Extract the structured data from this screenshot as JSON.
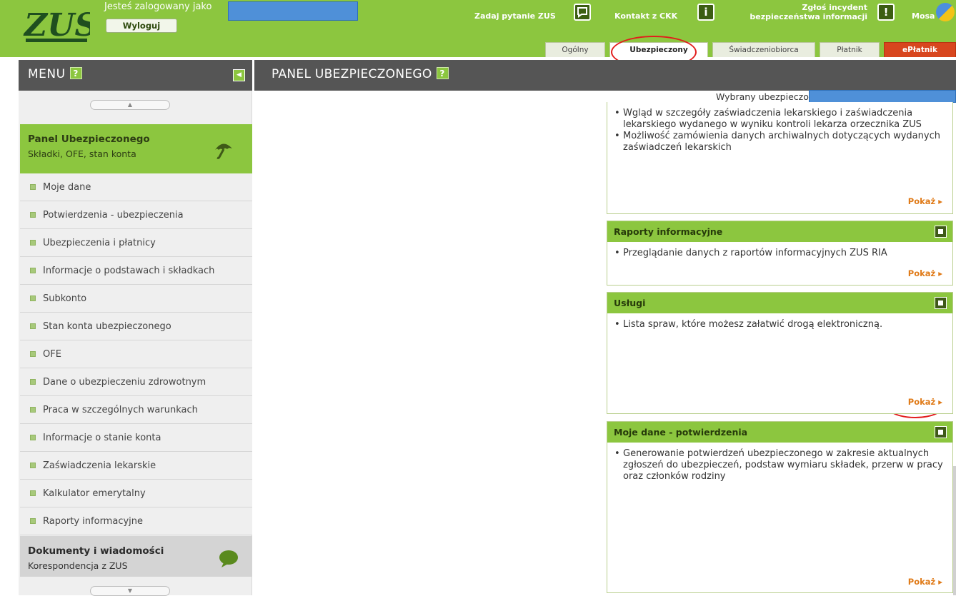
{
  "header": {
    "logged_as": "Jesteś zalogowany jako",
    "logout": "Wyloguj",
    "ask_zus": "Zadaj pytanie ZUS",
    "contact_ckk": "Kontakt z CKK",
    "incident_line1": "Zgłoś incydent",
    "incident_line2": "bezpieczeństwa informacji",
    "mode": "Mosa"
  },
  "tabs": [
    {
      "label": "Ogólny"
    },
    {
      "label": "Ubezpieczony"
    },
    {
      "label": "Świadczeniobiorca"
    },
    {
      "label": "Płatnik"
    },
    {
      "label": "ePłatnik"
    }
  ],
  "menu": {
    "title": "MENU",
    "help": "?",
    "panel": {
      "title": "Panel Ubezpieczonego",
      "subtitle": "Składki, OFE, stan konta"
    },
    "items": [
      {
        "label": "Moje dane"
      },
      {
        "label": "Potwierdzenia - ubezpieczenia"
      },
      {
        "label": "Ubezpieczenia i płatnicy"
      },
      {
        "label": "Informacje o podstawach i składkach"
      },
      {
        "label": "Subkonto"
      },
      {
        "label": "Stan konta ubezpieczonego"
      },
      {
        "label": "OFE"
      },
      {
        "label": "Dane o ubezpieczeniu zdrowotnym"
      },
      {
        "label": "Praca w szczególnych warunkach"
      },
      {
        "label": "Informacje o stanie konta"
      },
      {
        "label": "Zaświadczenia lekarskie"
      },
      {
        "label": "Kalkulator emerytalny"
      },
      {
        "label": "Raporty informacyjne"
      }
    ],
    "docs": {
      "title": "Dokumenty i wiadomości",
      "subtitle": "Korespondencja z ZUS"
    }
  },
  "panel": {
    "title": "PANEL UBEZPIECZONEGO",
    "selected_label": "Wybrany ubezpieczony:",
    "show_label": "Pokaż ▸",
    "cards": [
      {
        "items": [
          "Wgląd w szczegóły zaświadczenia lekarskiego i zaświadczenia lekarskiego wydanego w wyniku kontroli lekarza orzecznika ZUS",
          "Możliwość zamówienia danych archiwalnych dotyczących wydanych zaświadczeń lekarskich"
        ]
      },
      {
        "title": "Raporty informacyjne",
        "items": [
          "Przeglądanie danych z raportów informacyjnych ZUS RIA"
        ]
      },
      {
        "title": "Usługi",
        "items": [
          "Lista spraw, które możesz załatwić drogą elektroniczną."
        ]
      },
      {
        "title": "Moje dane - potwierdzenia",
        "items": [
          "Generowanie potwierdzeń ubezpieczonego w zakresie aktualnych zgłoszeń do ubezpieczeń, podstaw wymiaru składek, przerw w pracy oraz członków rodziny"
        ]
      }
    ]
  },
  "colors": {
    "brand_green": "#8cc63f",
    "dark_bar": "#555555",
    "link_orange": "#e07b19",
    "eplatnik_red": "#d8461e",
    "annotation_red": "#e21c1c"
  },
  "icons": [
    "zus-logo",
    "question-icon",
    "info-icon",
    "umbrella-icon",
    "speech-bubble-icon",
    "collapse-icon"
  ]
}
